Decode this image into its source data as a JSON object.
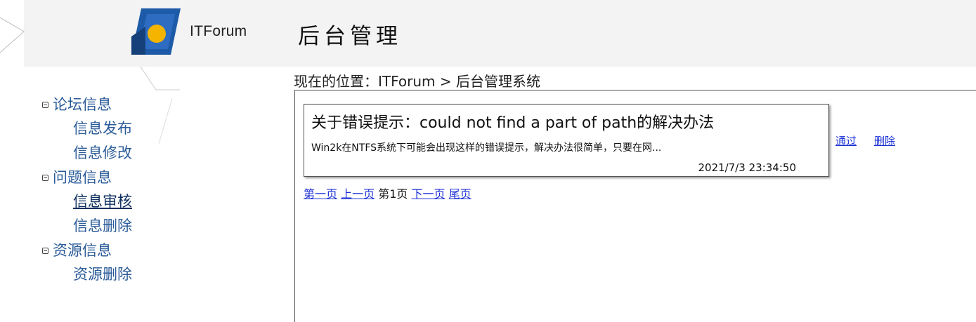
{
  "header": {
    "logo_text": "ITForum",
    "page_title": "后台管理"
  },
  "breadcrumb": "现在的位置：ITForum > 后台管理系统",
  "sidebar": {
    "groups": [
      {
        "label": "论坛信息",
        "items": [
          {
            "label": "信息发布"
          },
          {
            "label": "信息修改"
          }
        ]
      },
      {
        "label": "问题信息",
        "items": [
          {
            "label": "信息审核"
          },
          {
            "label": "信息删除"
          }
        ]
      },
      {
        "label": "资源信息",
        "items": [
          {
            "label": "资源删除"
          }
        ]
      }
    ]
  },
  "post": {
    "title": "关于错误提示：could not find a part of path的解决办法",
    "summary": "Win2k在NTFS系统下可能会出现这样的错误提示，解决办法很简单，只要在网...",
    "time": "2021/7/3 23:34:50",
    "approve_label": "通过",
    "delete_label": "删除"
  },
  "pager": {
    "first": "第一页",
    "prev": "上一页",
    "current": "第1页",
    "next": "下一页",
    "last": "尾页"
  },
  "colors": {
    "header_bg": "#f3f3f3",
    "sidebar_link": "#2a5b98",
    "link": "#1a2fd6",
    "logo_blue": "#1d5aa8",
    "logo_orange": "#f5b400"
  }
}
